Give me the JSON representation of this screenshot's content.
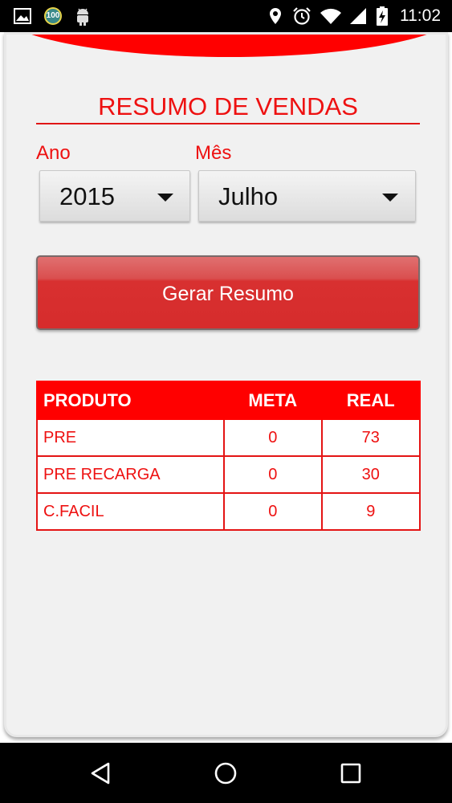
{
  "status_bar": {
    "time": "11:02",
    "left_icons": [
      "image-icon",
      "battery-saver-100-icon",
      "android-icon"
    ],
    "badge_text": "100",
    "right_icons": [
      "location-icon",
      "alarm-icon",
      "wifi-icon",
      "signal-icon",
      "battery-charging-icon"
    ]
  },
  "header": {
    "title": "RESUMO DE VENDAS"
  },
  "filters": {
    "year_label": "Ano",
    "year_value": "2015",
    "month_label": "Mês",
    "month_value": "Julho"
  },
  "actions": {
    "generate_label": "Gerar Resumo"
  },
  "table": {
    "columns": [
      "PRODUTO",
      "META",
      "REAL"
    ],
    "rows": [
      {
        "produto": "PRE",
        "meta": "0",
        "real": "73"
      },
      {
        "produto": "PRE RECARGA",
        "meta": "0",
        "real": "30"
      },
      {
        "produto": "C.FACIL",
        "meta": "0",
        "real": "9"
      }
    ]
  },
  "colors": {
    "accent": "#ff0000",
    "text_red": "#ee1111",
    "background": "#f1f1f1"
  },
  "nav_bar": {
    "icons": [
      "back-icon",
      "home-icon",
      "recents-icon"
    ]
  }
}
